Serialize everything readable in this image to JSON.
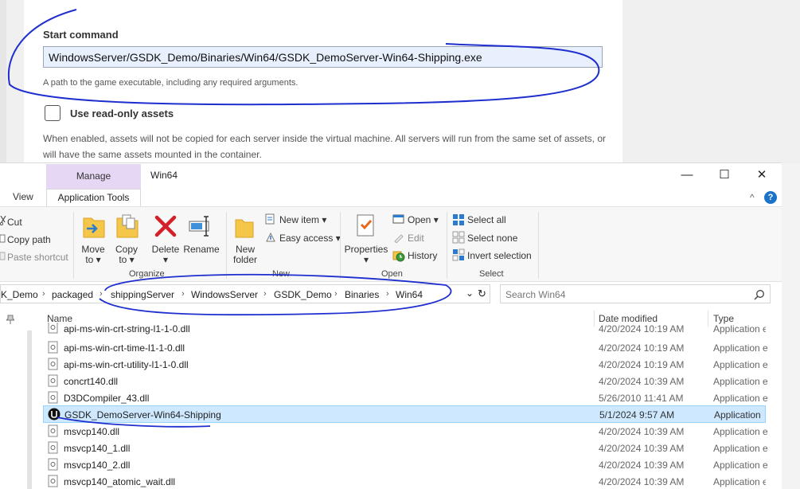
{
  "form": {
    "start_label": "Start command",
    "start_value": "WindowsServer/GSDK_Demo/Binaries/Win64/GSDK_DemoServer-Win64-Shipping.exe",
    "start_help": "A path to the game executable, including any required arguments.",
    "readonly_label": "Use read-only assets",
    "readonly_desc": "When enabled, assets will not be copied for each server inside the virtual machine. All servers will run from the same set of assets, or will have the same assets mounted in the container."
  },
  "explorer": {
    "manage_tab": "Manage",
    "title": "Win64",
    "minimize": "—",
    "maximize": "☐",
    "close": "✕",
    "tab_view": "View",
    "tab_app_tools": "Application Tools",
    "collapse_glyph": "^",
    "help_glyph": "?",
    "ribbon": {
      "cut": "Cut",
      "copy_path": "Copy path",
      "paste_shortcut": "Paste shortcut",
      "move_to_1": "Move",
      "move_to_2": "to ▾",
      "copy_to_1": "Copy",
      "copy_to_2": "to ▾",
      "delete_1": "Delete",
      "delete_2": "▾",
      "rename": "Rename",
      "group_organize": "Organize",
      "new_folder_1": "New",
      "new_folder_2": "folder",
      "new_item": "New item ▾",
      "easy_access": "Easy access ▾",
      "group_new": "New",
      "properties_1": "Properties",
      "properties_2": "▾",
      "open": "Open ▾",
      "edit": "Edit",
      "history": "History",
      "group_open": "Open",
      "select_all": "Select all",
      "select_none": "Select none",
      "invert_selection": "Invert selection",
      "group_select": "Select"
    },
    "breadcrumb": [
      "K_Demo",
      "packaged",
      "shippingServer",
      "WindowsServer",
      "GSDK_Demo",
      "Binaries",
      "Win64"
    ],
    "crumb_sep": "›",
    "addr_dropdown": "⌄",
    "refresh": "↻",
    "search_placeholder": "Search Win64",
    "columns": {
      "name": "Name",
      "date": "Date modified",
      "type": "Type"
    },
    "files": [
      {
        "name": "api-ms-win-crt-string-l1-1-0.dll",
        "date": "4/20/2024 10:19 AM",
        "type": "Application e"
      },
      {
        "name": "api-ms-win-crt-time-l1-1-0.dll",
        "date": "4/20/2024 10:19 AM",
        "type": "Application e"
      },
      {
        "name": "api-ms-win-crt-utility-l1-1-0.dll",
        "date": "4/20/2024 10:19 AM",
        "type": "Application e"
      },
      {
        "name": "concrt140.dll",
        "date": "4/20/2024 10:39 AM",
        "type": "Application e"
      },
      {
        "name": "D3DCompiler_43.dll",
        "date": "5/26/2010 11:41 AM",
        "type": "Application e"
      },
      {
        "name": "GSDK_DemoServer-Win64-Shipping",
        "date": "5/1/2024 9:57 AM",
        "type": "Application"
      },
      {
        "name": "msvcp140.dll",
        "date": "4/20/2024 10:39 AM",
        "type": "Application e"
      },
      {
        "name": "msvcp140_1.dll",
        "date": "4/20/2024 10:39 AM",
        "type": "Application e"
      },
      {
        "name": "msvcp140_2.dll",
        "date": "4/20/2024 10:39 AM",
        "type": "Application e"
      },
      {
        "name": "msvcp140_atomic_wait.dll",
        "date": "4/20/2024 10:39 AM",
        "type": "Application e"
      }
    ],
    "selected_file": "GSDK_DemoServer-Win64-Shipping",
    "accent": "#cde8ff",
    "annotation_color": "#1f2fcf"
  }
}
